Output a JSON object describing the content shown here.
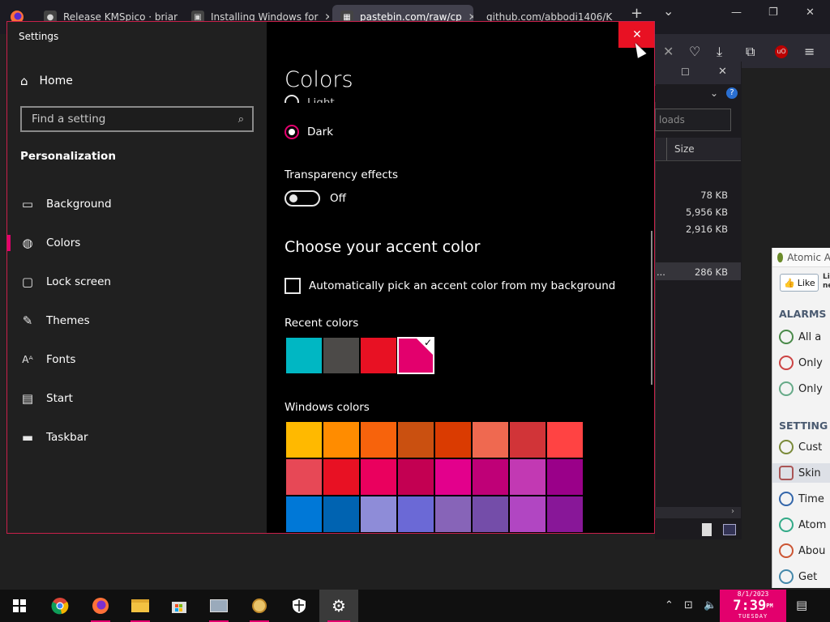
{
  "browser": {
    "tabs": [
      {
        "title": "Release KMSpico · briar",
        "favicon": "github-icon"
      },
      {
        "title": "Installing Windows for",
        "favicon": "doc-icon"
      },
      {
        "title": "pastebin.com/raw/cp",
        "favicon": "pastebin-icon",
        "active": true
      },
      {
        "title": "github.com/abbodi1406/K",
        "favicon": "none"
      }
    ],
    "new_tab": "+",
    "tab_list": "⌄"
  },
  "downloads": {
    "search_placeholder": "loads",
    "column_size": "Size",
    "sizes": [
      "78 KB",
      "5,956 KB",
      "2,916 KB",
      "286 KB"
    ],
    "ellipsis": "..."
  },
  "alarm": {
    "title": "Atomic A",
    "like": "Like",
    "like_aux_top": "Li",
    "like_aux_bottom": "ne",
    "sections": {
      "alarms": "ALARMS",
      "settings": "SETTING"
    },
    "alarm_items": [
      "All a",
      "Only",
      "Only"
    ],
    "setting_items": [
      "Cust",
      "Skin",
      "Time",
      "Atom",
      "Abou",
      "Get"
    ]
  },
  "settings": {
    "window_title": "Settings",
    "home": "Home",
    "search_placeholder": "Find a setting",
    "section": "Personalization",
    "nav": [
      {
        "label": "Background",
        "icon": "image-icon"
      },
      {
        "label": "Colors",
        "icon": "palette-icon",
        "selected": true
      },
      {
        "label": "Lock screen",
        "icon": "lock-screen-icon"
      },
      {
        "label": "Themes",
        "icon": "themes-icon"
      },
      {
        "label": "Fonts",
        "icon": "fonts-icon"
      },
      {
        "label": "Start",
        "icon": "start-icon"
      },
      {
        "label": "Taskbar",
        "icon": "taskbar-icon"
      }
    ],
    "page_title": "Colors",
    "radio_light": "Light",
    "radio_dark": "Dark",
    "transparency_label": "Transparency effects",
    "transparency_state": "Off",
    "accent_heading": "Choose your accent color",
    "auto_accent": "Automatically pick an accent color from my background",
    "recent_label": "Recent colors",
    "recent_colors": [
      "#00b7c3",
      "#4c4a48",
      "#e81123",
      "#e3006d"
    ],
    "windows_label": "Windows colors",
    "windows_colors": [
      [
        "#ffb900",
        "#ff8c00",
        "#f7630c",
        "#ca5010",
        "#da3b01",
        "#ef6950",
        "#d13438",
        "#ff4343"
      ],
      [
        "#e74856",
        "#e81123",
        "#ea005e",
        "#c30052",
        "#e3008c",
        "#bf0077",
        "#c239b3",
        "#9a0089"
      ],
      [
        "#0078d7",
        "#0063b1",
        "#8e8cd8",
        "#6b69d6",
        "#8764b8",
        "#744da9",
        "#b146c2",
        "#881798"
      ]
    ]
  },
  "clock": {
    "date": "8/1/2023",
    "time": "7:39",
    "ampm": "PM",
    "day": "TUESDAY"
  },
  "accent": "#e3006d"
}
